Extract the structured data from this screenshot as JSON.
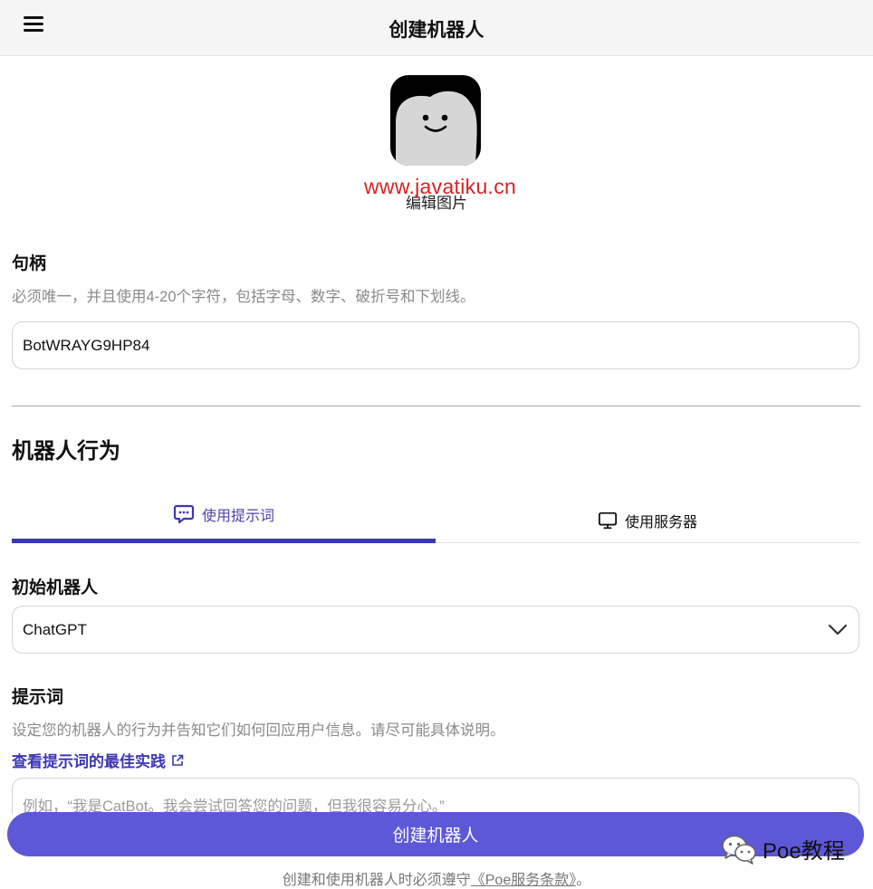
{
  "header": {
    "title": "创建机器人",
    "menu_icon": "hamburger-menu-icon"
  },
  "avatar": {
    "edit_label": "编辑图片",
    "watermark": "www.javatiku.cn"
  },
  "handle": {
    "label": "句柄",
    "helper": "必须唯一，并且使用4-20个字符，包括字母、数字、破折号和下划线。",
    "value": "BotWRAYG9HP84"
  },
  "behavior": {
    "heading": "机器人行为",
    "tabs": [
      {
        "label": "使用提示词",
        "icon": "chat-bubble-icon",
        "active": true
      },
      {
        "label": "使用服务器",
        "icon": "monitor-icon",
        "active": false
      }
    ],
    "base_bot": {
      "label": "初始机器人",
      "value": "ChatGPT"
    },
    "prompt": {
      "label": "提示词",
      "helper": "设定您的机器人的行为并告知它们如何回应用户信息。请尽可能具体说明。",
      "best_practices_link": "查看提示词的最佳实践",
      "placeholder": "例如，“我是CatBot。我会尝试回答您的问题，但我很容易分心。”"
    }
  },
  "footer": {
    "create_button": "创建机器人",
    "terms_prefix": "创建和使用机器人时必须遵守",
    "terms_link": "《Poe服务条款》",
    "terms_suffix": "。",
    "brand_text": "Poe教程"
  },
  "colors": {
    "accent": "#3d37b6",
    "button": "#5d58d8",
    "watermark": "#d62222"
  }
}
